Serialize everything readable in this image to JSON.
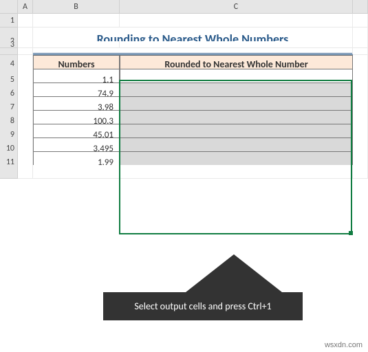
{
  "columns": [
    "A",
    "B",
    "C"
  ],
  "rows": [
    1,
    2,
    3,
    4,
    5,
    6,
    7,
    8,
    9,
    10,
    11
  ],
  "title": "Rounding to Nearest Whole Numbers",
  "headers": {
    "numbers": "Numbers",
    "rounded": "Rounded to Nearest Whole Number"
  },
  "values": [
    "1.1",
    "74.9",
    "3.98",
    "100.3",
    "45.01",
    "3.495",
    "1.99"
  ],
  "callout": "Select output cells and press Ctrl+1",
  "watermark": "wsxdn.com",
  "chart_data": {
    "type": "table",
    "title": "Rounding to Nearest Whole Numbers",
    "columns": [
      "Numbers",
      "Rounded to Nearest Whole Number"
    ],
    "rows": [
      [
        1.1,
        null
      ],
      [
        74.9,
        null
      ],
      [
        3.98,
        null
      ],
      [
        100.3,
        null
      ],
      [
        45.01,
        null
      ],
      [
        3.495,
        null
      ],
      [
        1.99,
        null
      ]
    ]
  }
}
